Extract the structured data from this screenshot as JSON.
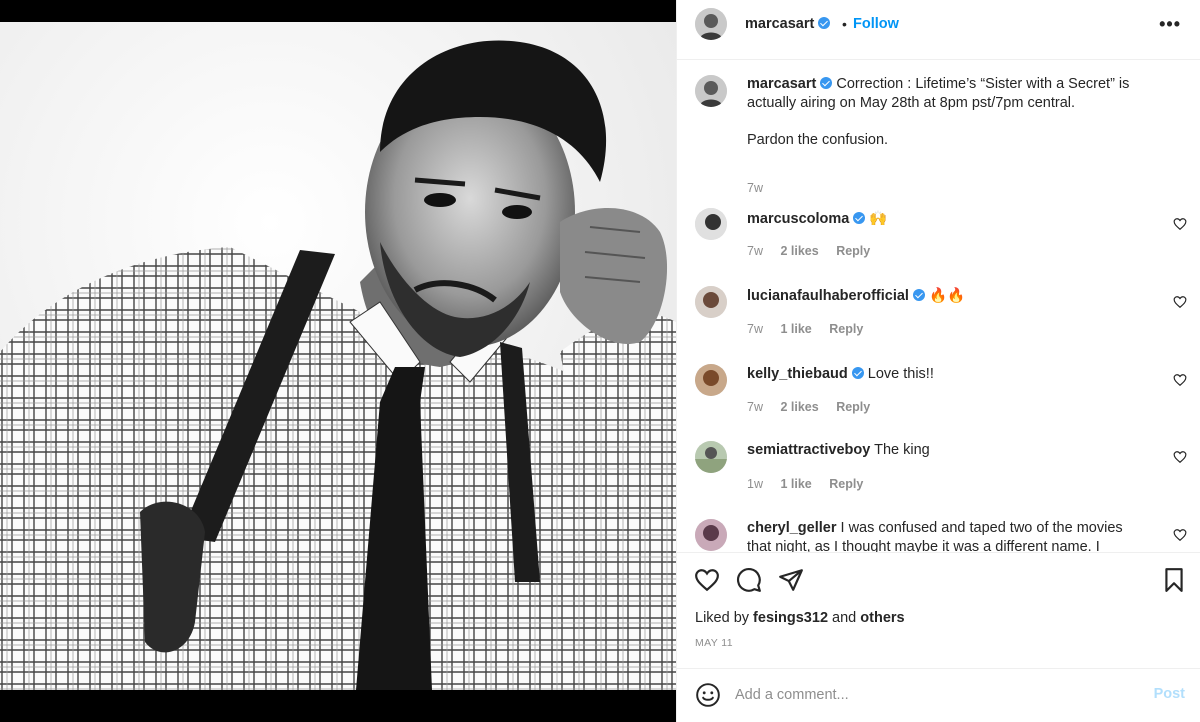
{
  "post": {
    "username": "marcasart",
    "separator": "•",
    "follow_label": "Follow",
    "more_label": "•••"
  },
  "caption": {
    "username": "marcasart",
    "text_line1": "Correction : Lifetime’s “Sister with a Secret” is",
    "text_line2": "actually airing on May 28th at 8pm pst/7pm central.",
    "text_line3": "Pardon the confusion.",
    "time": "7w"
  },
  "comments": [
    {
      "username": "marcuscoloma",
      "verified": true,
      "text": "🙌",
      "time": "7w",
      "likes": "2 likes",
      "reply": "Reply"
    },
    {
      "username": "lucianafaulhaberofficial",
      "verified": true,
      "text": "🔥🔥",
      "time": "7w",
      "likes": "1 like",
      "reply": "Reply"
    },
    {
      "username": "kelly_thiebaud",
      "verified": true,
      "text": "Love this!!",
      "time": "7w",
      "likes": "2 likes",
      "reply": "Reply"
    },
    {
      "username": "semiattractiveboy",
      "verified": false,
      "text": "The king",
      "time": "1w",
      "likes": "1 like",
      "reply": "Reply"
    },
    {
      "username": "cheryl_geller",
      "verified": false,
      "text": "I was confused and taped two of the movies",
      "text2": "that night, as I thought maybe it was a different name. I",
      "time": "",
      "likes": "",
      "reply": ""
    }
  ],
  "actions": {
    "liked_prefix": "Liked by",
    "liked_user": "fesings312",
    "liked_and": "and",
    "liked_others": "others",
    "date": "MAY 11"
  },
  "composer": {
    "placeholder": "Add a comment...",
    "post_label": "Post"
  },
  "colors": {
    "accent": "#0095f6",
    "verified": "#3897f0",
    "muted": "#8e8e8e"
  }
}
